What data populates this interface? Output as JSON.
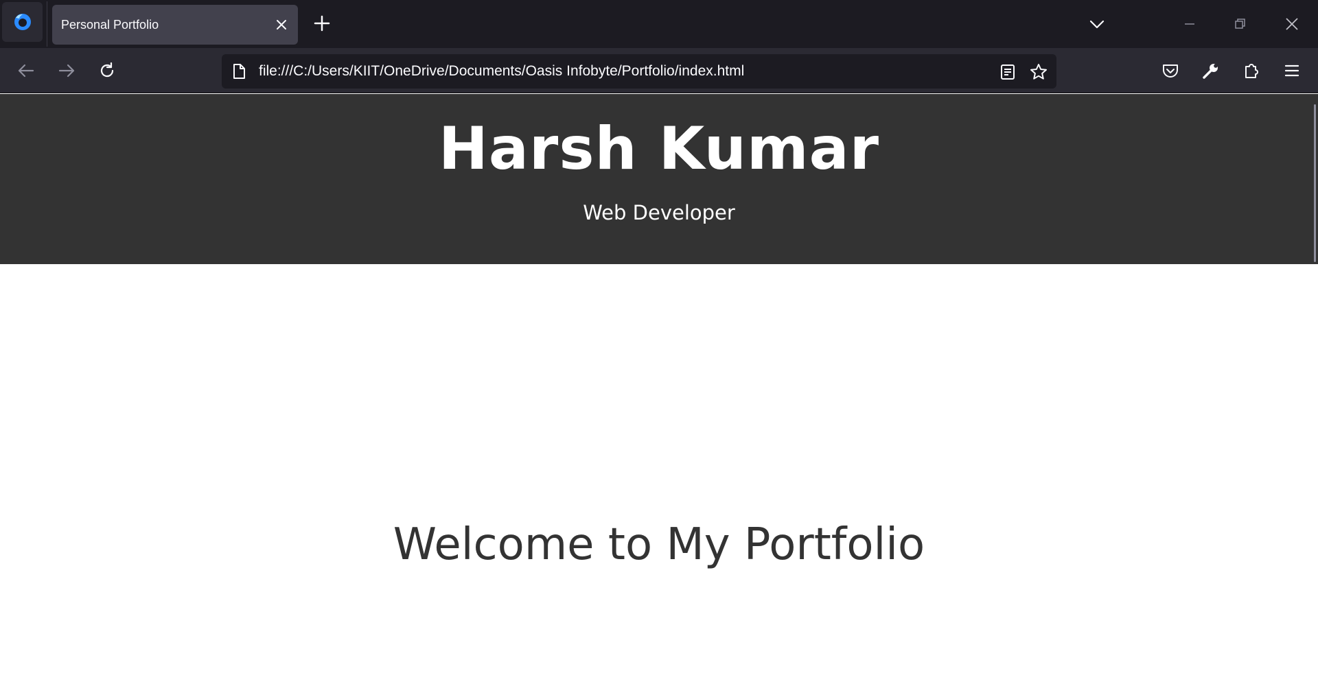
{
  "browser": {
    "tab": {
      "title": "Personal Portfolio"
    },
    "url": "file:///C:/Users/KIIT/OneDrive/Documents/Oasis Infobyte/Portfolio/index.html",
    "accent_color": "#1c1b22"
  },
  "page": {
    "header": {
      "name": "Harsh Kumar",
      "role": "Web Developer",
      "background": "#333333"
    },
    "welcome_heading": "Welcome to My Portfolio"
  }
}
